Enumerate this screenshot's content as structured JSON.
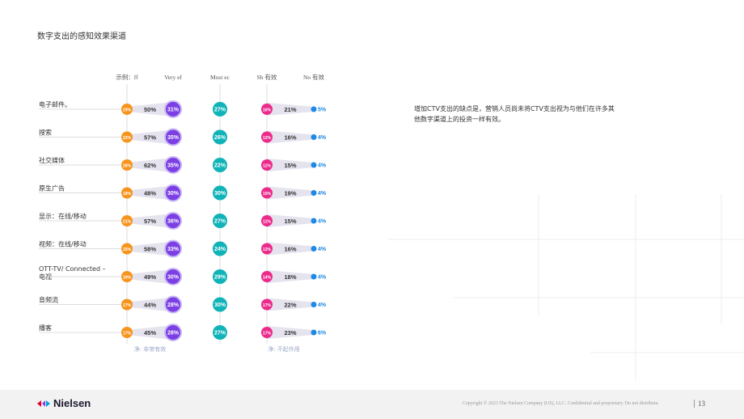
{
  "page": {
    "title": "数字支出的感知效果渠道",
    "note": "增加CTV支出的缺点是，营销人员尚未将CTV支出视为与他们在许多其他数字渠道上的投资一样有效。",
    "footer": {
      "logo_text": "Nielsen",
      "copyright": "Copyright © 2023 The Nielsen Company (US), LLC. Confidential and proprietary. Do not distribute.",
      "page_number": "13"
    }
  },
  "chart_data": {
    "type": "dot-plot",
    "column_headers": [
      "示例：ff",
      "Very ef",
      "Most ec",
      "Sh 有效",
      "No 有效"
    ],
    "net_labels": [
      "净: 非常有效",
      "净: 不起作用"
    ],
    "unit": "%",
    "categories": [
      "电子邮件。",
      "搜索",
      "社交媒体",
      "原生广告",
      "显示：在线/移动",
      "视频：在线/移动",
      "OTT-TV/ Connected – 电视",
      "音频流",
      "播客"
    ],
    "net_effective": [
      50,
      57,
      62,
      48,
      57,
      58,
      49,
      44,
      45
    ],
    "net_not_effective": [
      21,
      16,
      15,
      19,
      15,
      16,
      18,
      22,
      23
    ],
    "series": [
      {
        "name": "示例：ff",
        "color": "#f7941d",
        "values": [
          19,
          22,
          26,
          18,
          21,
          25,
          19,
          17,
          17
        ]
      },
      {
        "name": "Very ef",
        "color": "#7b3fe4",
        "values": [
          31,
          35,
          35,
          30,
          36,
          33,
          30,
          28,
          28
        ]
      },
      {
        "name": "Most ec",
        "color": "#10b3b8",
        "values": [
          27,
          26,
          22,
          30,
          27,
          24,
          29,
          30,
          27
        ]
      },
      {
        "name": "Sh 有效",
        "color": "#ec2a8c",
        "values": [
          16,
          12,
          11,
          15,
          11,
          12,
          14,
          17,
          17
        ]
      },
      {
        "name": "No 有效",
        "color": "#1e88e5",
        "values": [
          5,
          4,
          4,
          4,
          4,
          4,
          4,
          4,
          6
        ]
      }
    ]
  }
}
